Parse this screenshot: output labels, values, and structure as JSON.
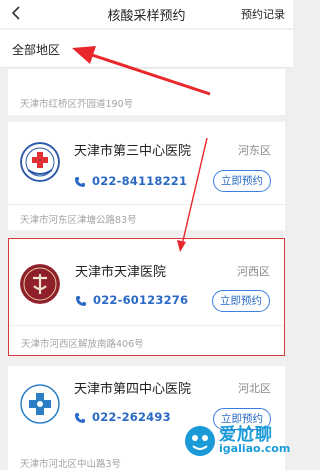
{
  "header": {
    "title": "核酸采样预约",
    "history_label": "预约记录"
  },
  "filter": {
    "label": "全部地区"
  },
  "previous_card": {
    "address": "天津市红桥区芥园道190号"
  },
  "hospitals": [
    {
      "name": "天津市第三中心医院",
      "district": "河东区",
      "phone": "022-84118221",
      "book_label": "立即预约",
      "address": "天津市河东区津塘公路83号"
    },
    {
      "name": "天津市天津医院",
      "district": "河西区",
      "phone": "022-60123276",
      "book_label": "立即预约",
      "address": "天津市河西区解放南路406号"
    },
    {
      "name": "天津市第四中心医院",
      "district": "河北区",
      "phone": "022-262493",
      "book_label": "立即预约",
      "address": "天津市河北区中山路3号"
    }
  ],
  "watermark": {
    "text": "爱尬聊",
    "url": "igaliao.com"
  },
  "colors": {
    "accent_blue": "#2a69c6",
    "highlight_red": "#d9373a",
    "watermark_blue": "#1a9bd8"
  }
}
